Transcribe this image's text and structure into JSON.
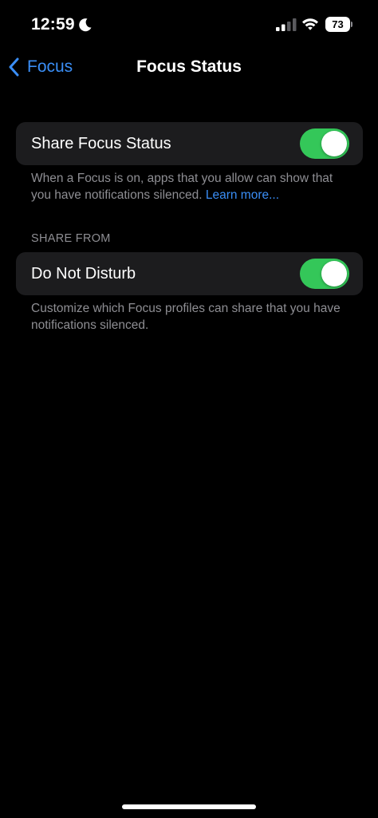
{
  "status_bar": {
    "time": "12:59",
    "battery_level": "73",
    "focus_icon": "moon-icon",
    "signal_icon": "cellular-signal-icon",
    "wifi_icon": "wifi-icon"
  },
  "nav": {
    "back_label": "Focus",
    "title": "Focus Status",
    "back_icon": "chevron-left-icon"
  },
  "share_focus": {
    "label": "Share Focus Status",
    "enabled": true,
    "footer_text": "When a Focus is on, apps that you allow can show that you have notifications silenced. ",
    "footer_link": "Learn more..."
  },
  "share_from": {
    "header": "SHARE FROM",
    "items": [
      {
        "label": "Do Not Disturb",
        "enabled": true
      }
    ],
    "footer_text": "Customize which Focus profiles can share that you have notifications silenced."
  },
  "colors": {
    "background": "#000000",
    "cell_background": "#1c1c1e",
    "accent_blue": "#3a8ef6",
    "toggle_on": "#34c759",
    "secondary_text": "#8e8e93"
  }
}
